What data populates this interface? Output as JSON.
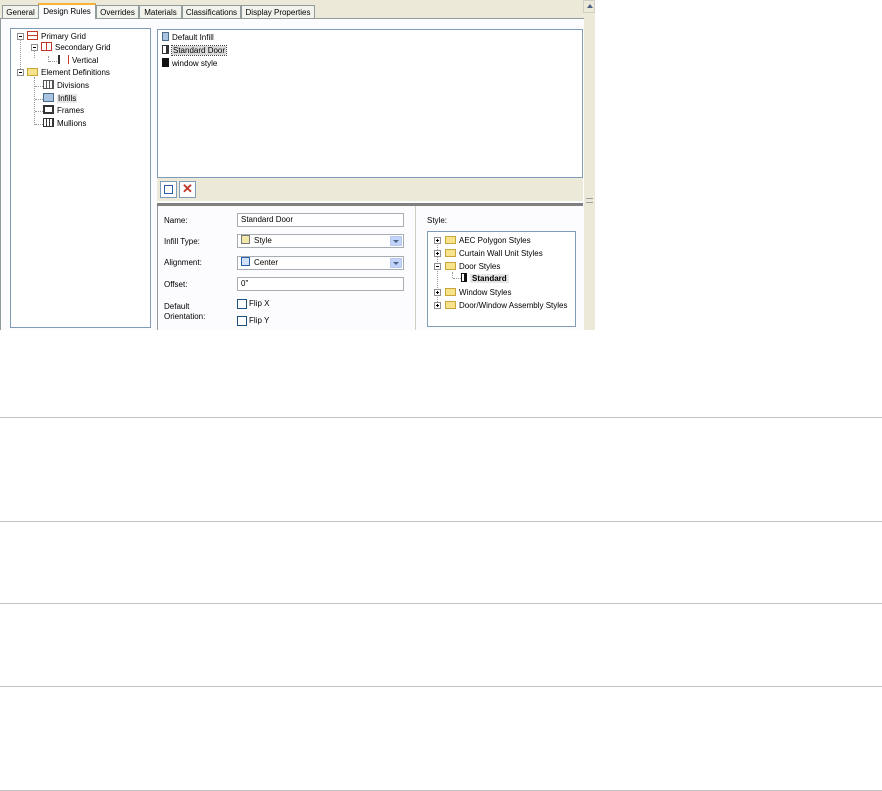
{
  "tabs": [
    {
      "label": "General"
    },
    {
      "label": "Design Rules"
    },
    {
      "label": "Overrides"
    },
    {
      "label": "Materials"
    },
    {
      "label": "Classifications"
    },
    {
      "label": "Display Properties"
    }
  ],
  "active_tab": "Design Rules",
  "element_tree": {
    "primary_grid": "Primary Grid",
    "secondary_grid": "Secondary Grid",
    "vertical": "Vertical",
    "element_definitions": "Element Definitions",
    "divisions": "Divisions",
    "infills": "Infills",
    "frames": "Frames",
    "mullions": "Mullions"
  },
  "infill_list": [
    {
      "label": "Default Infill",
      "icon": "infill-icon"
    },
    {
      "label": "Standard Door",
      "icon": "door-icon"
    },
    {
      "label": "window style",
      "icon": "window-style-icon"
    }
  ],
  "properties": {
    "name_label": "Name:",
    "name_value": "Standard Door",
    "infill_type_label": "Infill Type:",
    "infill_type_value": "Style",
    "alignment_label": "Alignment:",
    "alignment_value": "Center",
    "offset_label": "Offset:",
    "offset_value": "0\"",
    "default_orientation_label": "Default Orientation:",
    "flip_x_label": "Flip X",
    "flip_y_label": "Flip Y",
    "flip_x_checked": false,
    "flip_y_checked": false
  },
  "style_panel": {
    "label": "Style:",
    "items": [
      {
        "label": "AEC Polygon Styles"
      },
      {
        "label": "Curtain Wall Unit Styles"
      },
      {
        "label": "Door Styles"
      },
      {
        "label": "Standard"
      },
      {
        "label": "Window Styles"
      },
      {
        "label": "Door/Window Assembly Styles"
      }
    ]
  },
  "colors": {
    "tab_accent": "#f8b236",
    "dialog_bg": "#ece9d8",
    "border_blue": "#7f9db9",
    "folder_yellow": "#f7e38b"
  }
}
